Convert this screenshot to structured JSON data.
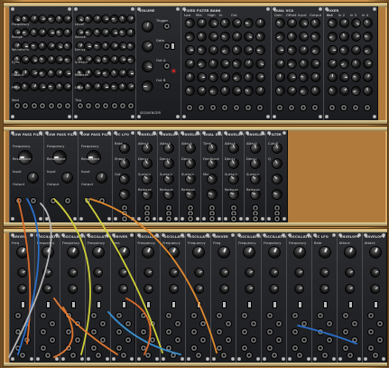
{
  "cabinets": [
    {
      "name": "top-cabinet",
      "panels": [
        {
          "title": "",
          "labels": [
            "Frequency",
            "Range",
            "Waveform",
            "Sync",
            "Output",
            "Pitch",
            "Mod"
          ],
          "footer": "",
          "knob_rows": 1
        },
        {
          "title": "",
          "labels": [
            "Level",
            "Attack",
            "Decay",
            "Sustain",
            "Release",
            "Gate",
            "Trig"
          ],
          "footer": "",
          "knob_rows": 1
        },
        {
          "title": "VOLUME",
          "labels": [
            "Trigger",
            "Gate",
            "Out A",
            "Out B"
          ],
          "footer": "SEQUENCER",
          "knob_rows": 0
        },
        {
          "title": "FIXED FILTER BANK",
          "labels": [
            "Low",
            "Mid",
            "High",
            "In",
            "Out"
          ],
          "footer": "",
          "knob_rows": 0
        },
        {
          "title": "DUAL VCA",
          "labels": [
            "Gain",
            "Offset",
            "Input",
            "Output"
          ],
          "footer": "",
          "knob_rows": 0
        },
        {
          "title": "MIXER",
          "labels": [
            "In 1",
            "In 2",
            "In 3",
            "In 4",
            "Out"
          ],
          "footer": "",
          "knob_rows": 0
        }
      ]
    },
    {
      "name": "middle-cabinet",
      "panels": [
        {
          "title": "LOW PASS FILTER",
          "labels": [
            "Frequency",
            "Resonance",
            "Input",
            "Output"
          ],
          "footer": "",
          "knob_rows": 0
        },
        {
          "title": "LOW PASS FILTER",
          "labels": [
            "Frequency",
            "Resonance",
            "Input",
            "Output"
          ],
          "footer": "",
          "knob_rows": 0
        },
        {
          "title": "LOW PASS FILTER",
          "labels": [
            "Frequency",
            "Resonance",
            "Input",
            "Output"
          ],
          "footer": "",
          "knob_rows": 0
        },
        {
          "title": "VC LFO",
          "labels": [
            "Rate",
            "Shape",
            "Out"
          ],
          "footer": "",
          "knob_rows": 0
        },
        {
          "title": "ENVELOPE",
          "labels": [
            "Attack",
            "Decay",
            "Sustain",
            "Release"
          ],
          "footer": "",
          "knob_rows": 0
        },
        {
          "title": "ENVELOPE",
          "labels": [
            "Attack",
            "Decay",
            "Sustain",
            "Release"
          ],
          "footer": "",
          "knob_rows": 0
        },
        {
          "title": "ENVELOPE",
          "labels": [
            "Attack",
            "Decay",
            "Sustain",
            "Release"
          ],
          "footer": "",
          "knob_rows": 0
        },
        {
          "title": "DUAL DELAY",
          "labels": [
            "Time",
            "Feedback",
            "Mix"
          ],
          "footer": "",
          "knob_rows": 0
        },
        {
          "title": "ENVELOPE",
          "labels": [
            "Attack",
            "Decay",
            "Sustain",
            "Release"
          ],
          "footer": "",
          "knob_rows": 0
        },
        {
          "title": "ENVELOPE",
          "labels": [
            "Attack",
            "Decay",
            "Sustain",
            "Release"
          ],
          "footer": "",
          "knob_rows": 0
        },
        {
          "title": "FILTER",
          "labels": [
            "Cutoff",
            "Q"
          ],
          "footer": "",
          "knob_rows": 0
        }
      ]
    },
    {
      "name": "bottom-cabinet",
      "panels": [
        {
          "title": "DRIVER",
          "labels": [
            "Freq"
          ],
          "footer": "",
          "knob_rows": 0
        },
        {
          "title": "OSCILLATOR",
          "labels": [
            "Frequency"
          ],
          "footer": "",
          "knob_rows": 0
        },
        {
          "title": "OSCILLATOR",
          "labels": [
            "Frequency"
          ],
          "footer": "",
          "knob_rows": 0
        },
        {
          "title": "OSCILLATOR",
          "labels": [
            "Frequency"
          ],
          "footer": "",
          "knob_rows": 0
        },
        {
          "title": "DRIVER",
          "labels": [
            "Freq"
          ],
          "footer": "",
          "knob_rows": 0
        },
        {
          "title": "OSCILLATOR",
          "labels": [
            "Frequency"
          ],
          "footer": "",
          "knob_rows": 0
        },
        {
          "title": "OSCILLATOR",
          "labels": [
            "Frequency"
          ],
          "footer": "",
          "knob_rows": 0
        },
        {
          "title": "OSCILLATOR",
          "labels": [
            "Frequency"
          ],
          "footer": "",
          "knob_rows": 0
        },
        {
          "title": "DRIVER",
          "labels": [
            "Freq"
          ],
          "footer": "",
          "knob_rows": 0
        },
        {
          "title": "OSCILLATOR",
          "labels": [
            "Frequency"
          ],
          "footer": "",
          "knob_rows": 0
        },
        {
          "title": "OSCILLATOR",
          "labels": [
            "Frequency"
          ],
          "footer": "",
          "knob_rows": 0
        },
        {
          "title": "OSCILLATOR",
          "labels": [
            "Frequency"
          ],
          "footer": "",
          "knob_rows": 0
        },
        {
          "title": "VC LFO",
          "labels": [
            "Rate"
          ],
          "footer": "",
          "knob_rows": 0
        },
        {
          "title": "ENVELOPE",
          "labels": [
            "Attack"
          ],
          "footer": "",
          "knob_rows": 0
        },
        {
          "title": "ENVELOPE",
          "labels": [
            "Attack"
          ],
          "footer": "",
          "knob_rows": 0
        }
      ]
    }
  ],
  "cable_colors": [
    "#d96a2a",
    "#2a6fc9",
    "#cfcf3a",
    "#e08a2e",
    "#3a8fd0",
    "#b8b8b8",
    "#e07830"
  ],
  "colors": {
    "wood": "#b07a3c",
    "panel": "#222327",
    "text": "#d8d8d8"
  }
}
